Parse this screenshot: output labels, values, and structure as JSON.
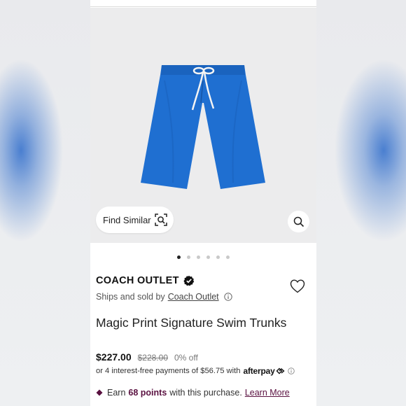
{
  "product": {
    "images_count": 6,
    "active_image_index": 0,
    "find_similar_label": "Find Similar"
  },
  "brand": {
    "name": "COACH OUTLET",
    "ships_prefix": "Ships and sold by",
    "seller": "Coach Outlet"
  },
  "title": "Magic Print Signature Swim Trunks",
  "pricing": {
    "price": "$227.00",
    "original_price": "$228.00",
    "discount": "0% off",
    "installments_text": "or 4 interest-free payments of $56.75 with",
    "installments_provider": "afterpay"
  },
  "rewards": {
    "prefix": "Earn",
    "points": "68 points",
    "suffix": "with this purchase.",
    "learn_more": "Learn More"
  },
  "colors": {
    "product_blue": "#1f6fd1",
    "rewards_accent": "#5a1140"
  },
  "icons": [
    "visual-search-icon",
    "zoom-icon",
    "verified-badge-icon",
    "heart-icon",
    "info-icon",
    "afterpay-icon",
    "diamond-icon"
  ]
}
